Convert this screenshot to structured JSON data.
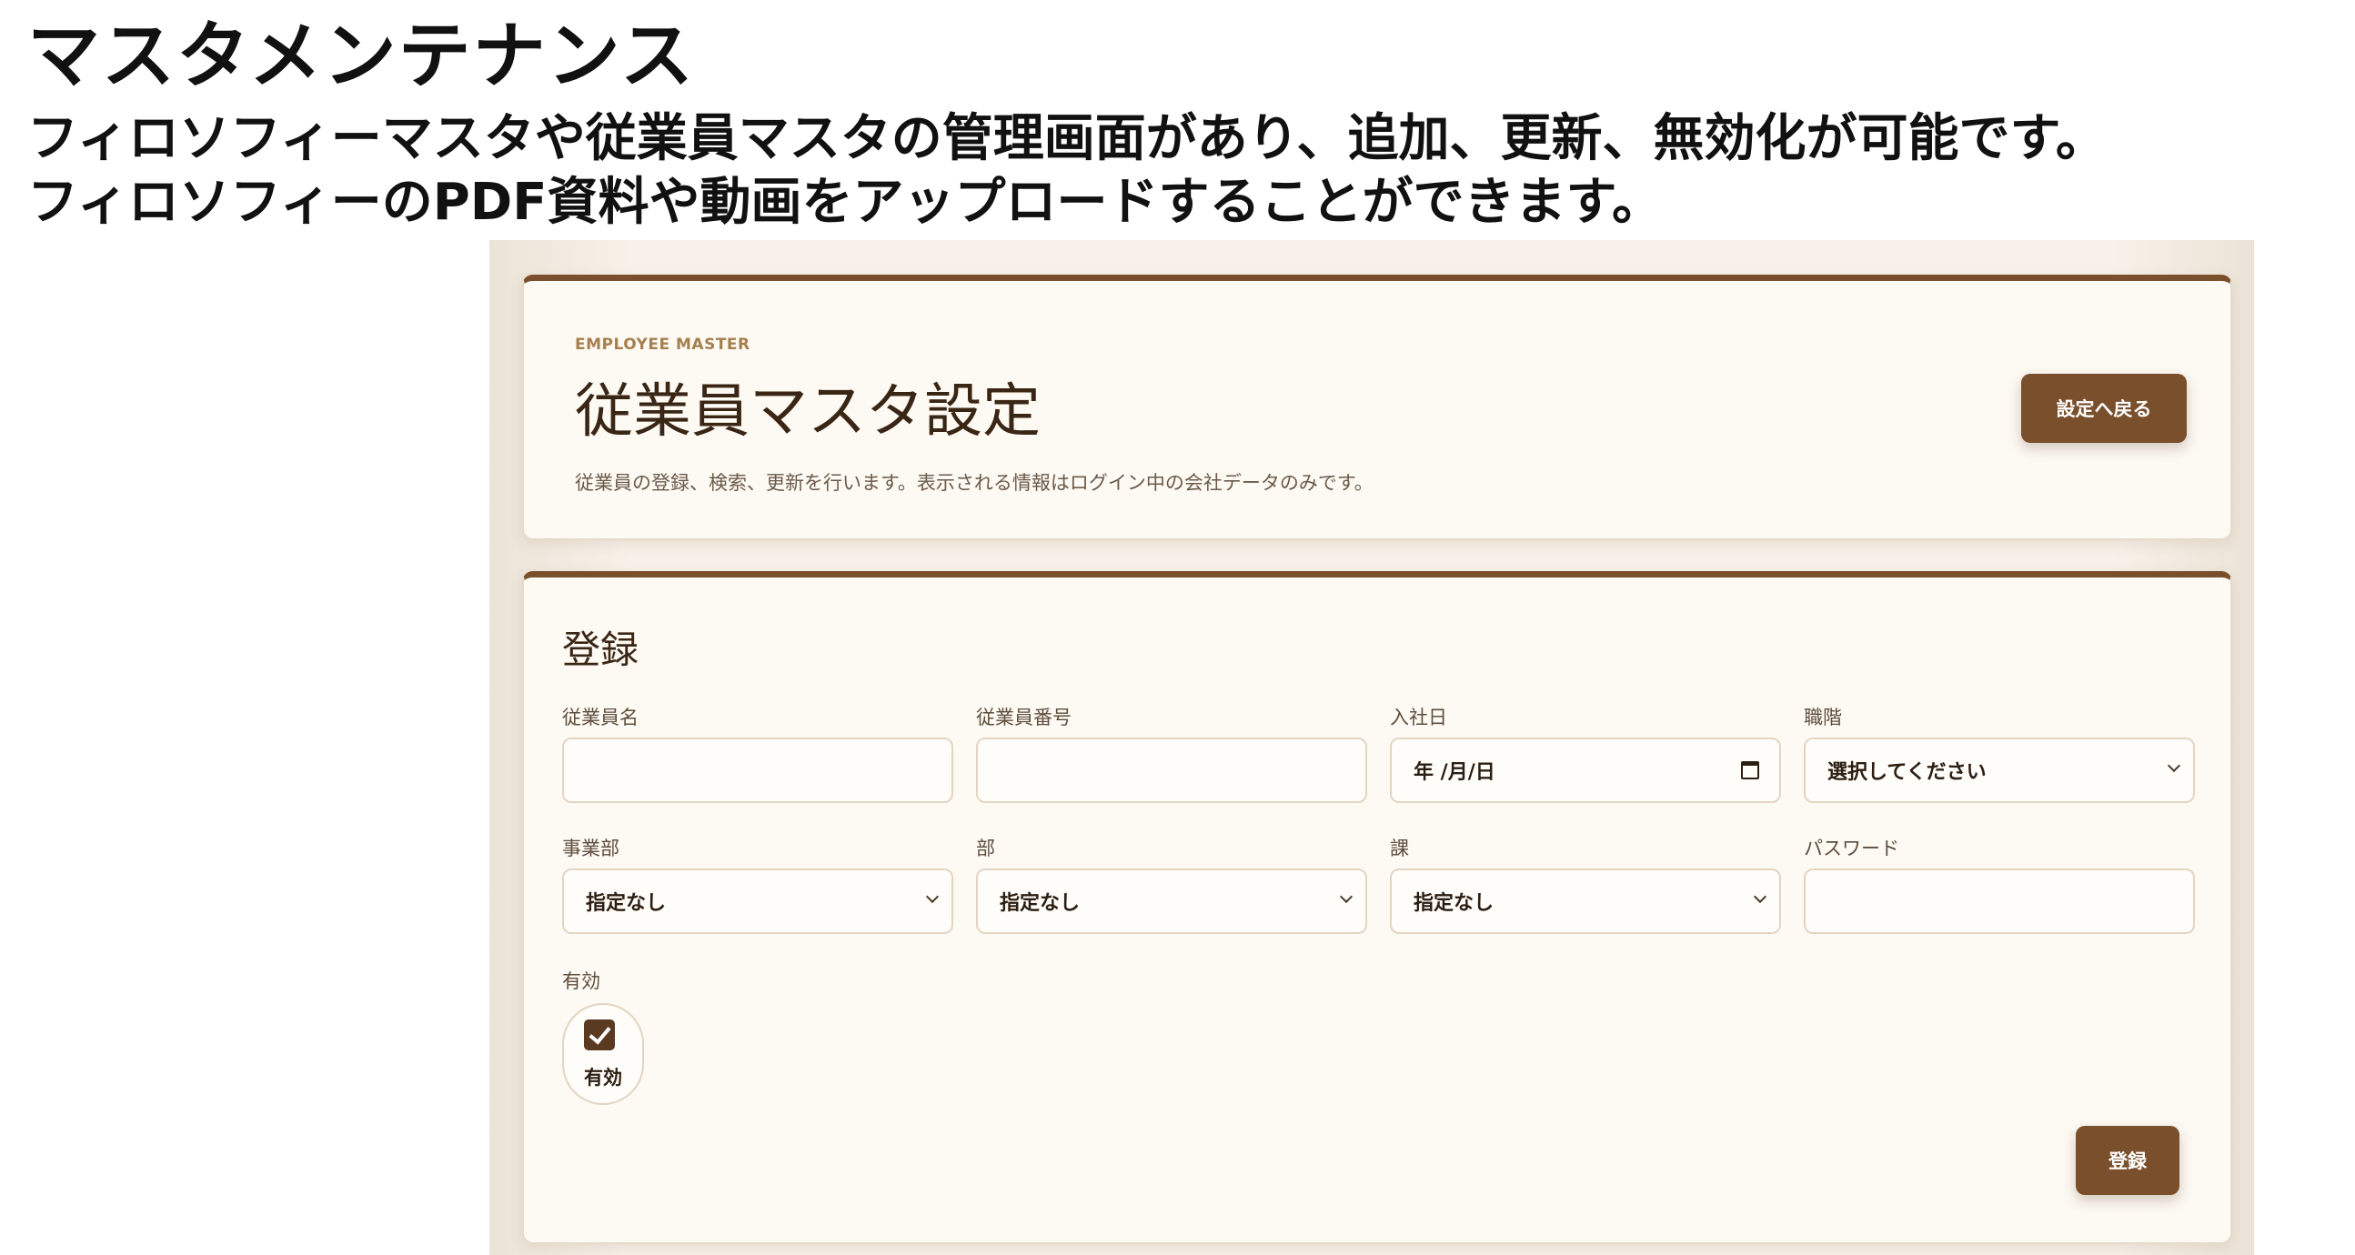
{
  "slide": {
    "title": "マスタメンテナンス",
    "desc_line1": "フィロソフィーマスタや従業員マスタの管理画面があり、追加、更新、無効化が可能です。",
    "desc_line2": "フィロソフィーのPDF資料や動画をアップロードすることができます。"
  },
  "header": {
    "eyebrow": "EMPLOYEE MASTER",
    "title": "従業員マスタ設定",
    "subtitle": "従業員の登録、検索、更新を行います。表示される情報はログイン中の会社データのみです。",
    "back_button": "設定へ戻る"
  },
  "form": {
    "section_title": "登録",
    "fields": {
      "name": {
        "label": "従業員名",
        "value": ""
      },
      "number": {
        "label": "従業員番号",
        "value": ""
      },
      "join_date": {
        "label": "入社日",
        "value": "年 /月/日"
      },
      "position": {
        "label": "職階",
        "value": "選択してください"
      },
      "division": {
        "label": "事業部",
        "value": "指定なし"
      },
      "department": {
        "label": "部",
        "value": "指定なし"
      },
      "section": {
        "label": "課",
        "value": "指定なし"
      },
      "password": {
        "label": "パスワード",
        "value": ""
      }
    },
    "active": {
      "label": "有効",
      "checkbox_label": "有効",
      "checked": true
    },
    "submit_button": "登録"
  },
  "colors": {
    "accent": "#7a4f2c",
    "background": "#f7f1e9",
    "card": "#fdf9f3"
  },
  "icons": [
    "calendar-icon",
    "chevron-down-icon",
    "check-icon"
  ]
}
